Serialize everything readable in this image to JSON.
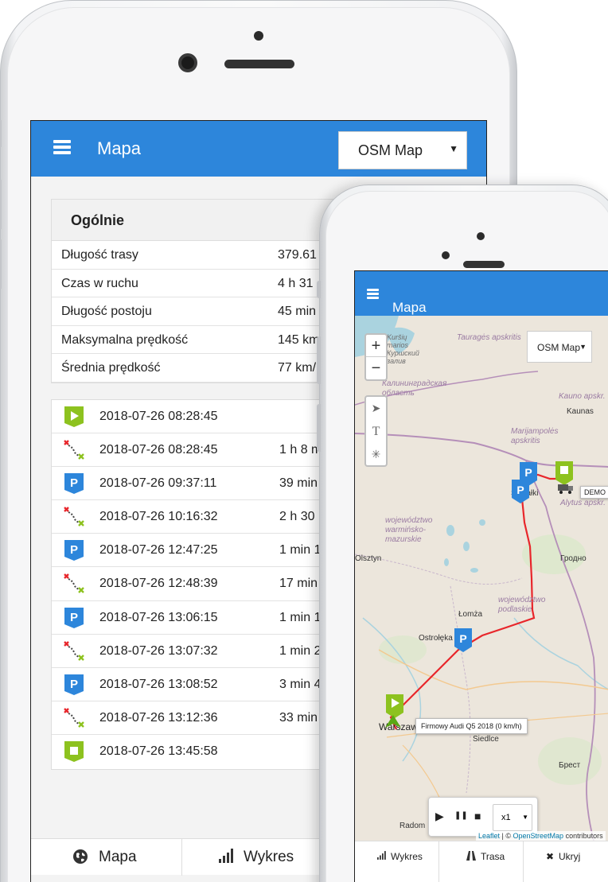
{
  "back_phone": {
    "appbar": {
      "title": "Mapa",
      "map_select": "OSM Map"
    },
    "summary": {
      "heading": "Ogólnie",
      "rows": [
        {
          "label": "Długość trasy",
          "value": "379.61"
        },
        {
          "label": "Czas w ruchu",
          "value": "4 h 31"
        },
        {
          "label": "Długość postoju",
          "value": "45 min"
        },
        {
          "label": "Maksymalna prędkość",
          "value": "145 km"
        },
        {
          "label": "Średnia prędkość",
          "value": "77 km/"
        }
      ]
    },
    "events": [
      {
        "type": "start",
        "timestamp": "2018-07-26 08:28:45",
        "duration": ""
      },
      {
        "type": "route",
        "timestamp": "2018-07-26 08:28:45",
        "duration": "1 h 8 m"
      },
      {
        "type": "parking",
        "timestamp": "2018-07-26 09:37:11",
        "duration": "39 min"
      },
      {
        "type": "route",
        "timestamp": "2018-07-26 10:16:32",
        "duration": "2 h 30"
      },
      {
        "type": "parking",
        "timestamp": "2018-07-26 12:47:25",
        "duration": "1 min 1"
      },
      {
        "type": "route",
        "timestamp": "2018-07-26 12:48:39",
        "duration": "17 min"
      },
      {
        "type": "parking",
        "timestamp": "2018-07-26 13:06:15",
        "duration": "1 min 1"
      },
      {
        "type": "route",
        "timestamp": "2018-07-26 13:07:32",
        "duration": "1 min 2"
      },
      {
        "type": "parking",
        "timestamp": "2018-07-26 13:08:52",
        "duration": "3 min 4"
      },
      {
        "type": "route",
        "timestamp": "2018-07-26 13:12:36",
        "duration": "33 min"
      },
      {
        "type": "stop",
        "timestamp": "2018-07-26 13:45:58",
        "duration": ""
      }
    ],
    "tabs": [
      {
        "icon": "globe-icon",
        "label": "Mapa"
      },
      {
        "icon": "signal-bars-icon",
        "label": "Wykres"
      }
    ]
  },
  "front_phone": {
    "appbar": {
      "title": "Mapa",
      "map_select": "OSM Map"
    },
    "zoom": {
      "in": "+",
      "out": "−"
    },
    "map_labels": {
      "lithuania_region": "Tauragės apskritis",
      "lagoon": "Kuršių marios Куршский залив",
      "kaliningrad": "Калининградская область",
      "kaunas_region": "Kauno apskr.",
      "kaunas": "Kaunas",
      "marijampole": "Marijampolės apskritis",
      "alytus": "Alytus apskr.",
      "suwalki": "Suwałki",
      "warmia": "województwo warmińsko-mazurskie",
      "olsztyn": "Olsztyn",
      "grodno": "Гродно",
      "lomza": "Łomża",
      "podlaskie": "województwo podlaskie",
      "ostroleka": "Ostrołęka",
      "warszawa": "Warszawa",
      "siedlce": "Siedlce",
      "brest": "Брест",
      "radom": "Radom",
      "demo_tag": "DEMO"
    },
    "tooltip": "Firmowy Audi Q5 2018 (0 km/h)",
    "player": {
      "play": "▶",
      "pause": "❚❚",
      "stop": "■",
      "speed": "x1"
    },
    "attribution": {
      "leaflet": "Leaflet",
      "sep": " | © ",
      "osm": "OpenStreetMap",
      "rest": " contributors"
    },
    "tabs": [
      {
        "icon": "signal-bars-icon",
        "label": "Wykres"
      },
      {
        "icon": "road-icon",
        "label": "Trasa"
      },
      {
        "icon": "close-icon",
        "label": "Ukryj"
      }
    ]
  },
  "colors": {
    "brand_blue": "#2d86db",
    "route_red": "#e8262b",
    "marker_green": "#8dc21f",
    "marker_blue": "#2d86db"
  }
}
